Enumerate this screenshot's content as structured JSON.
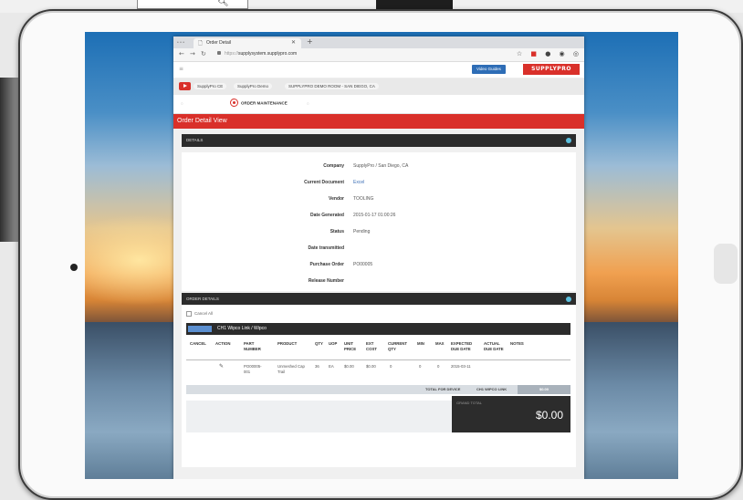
{
  "browser": {
    "tab_title": "Order Detail",
    "url_scheme": "https://",
    "url_host": "supplysystem.supplypro.com"
  },
  "header": {
    "video_guides": "Video Guides",
    "brand": "SUPPLYPRO"
  },
  "breadcrumb": [
    "SupplyPro CE",
    "SupplyPro Demo",
    "SUPPLYPRO DEMO ROOM - SAN DIEGO, CA"
  ],
  "subnav": {
    "active": "ORDER MAINTENANCE"
  },
  "page_title": "Order Detail View",
  "details": {
    "header": "DETAILS",
    "rows": [
      {
        "label": "Company",
        "value": "SupplyPro / San Diego, CA"
      },
      {
        "label": "Current Document",
        "value": "Excel"
      },
      {
        "label": "Vendor",
        "value": "TOOLING"
      },
      {
        "label": "Date Generated",
        "value": "2015-01-17 01:00:26"
      },
      {
        "label": "Status",
        "value": "Pending"
      },
      {
        "label": "Date transmitted",
        "value": ""
      },
      {
        "label": "Purchase Order",
        "value": "PO00005"
      },
      {
        "label": "Release Number",
        "value": ""
      }
    ]
  },
  "order_details": {
    "header": "ORDER DETAILS",
    "cancel_all": "Cancel All",
    "group": "CH1 Wipco Link / Wipco",
    "columns": {
      "cancel": "CANCEL",
      "action": "ACTION",
      "part": "PART NUMBER",
      "product": "PRODUCT",
      "qty": "QTY",
      "uop": "UOP",
      "unit_price": "UNIT PRICE",
      "ext_cost": "EXT COST",
      "current_qty": "CURRENT QTY",
      "min": "MIN",
      "max": "MAX",
      "due": "EXPECTED DUE DATE",
      "actual_due": "ACTUAL DUE DATE",
      "notes": "NOTES"
    },
    "row": {
      "part": "PO00005-001",
      "product": "Unmeshed Cap Trail",
      "qty": "36",
      "uop": "EA",
      "unit_price": "$0.00",
      "ext_cost": "$0.00",
      "current_qty": "0",
      "min": "0",
      "max": "0",
      "due": "2015-03-11"
    },
    "total_label": "TOTAL FOR DEVICE",
    "total_group": "CH1 WIPCO LINK",
    "total_value": "$0.00",
    "grand_label": "GRAND TOTAL",
    "grand_total": "$0.00"
  }
}
